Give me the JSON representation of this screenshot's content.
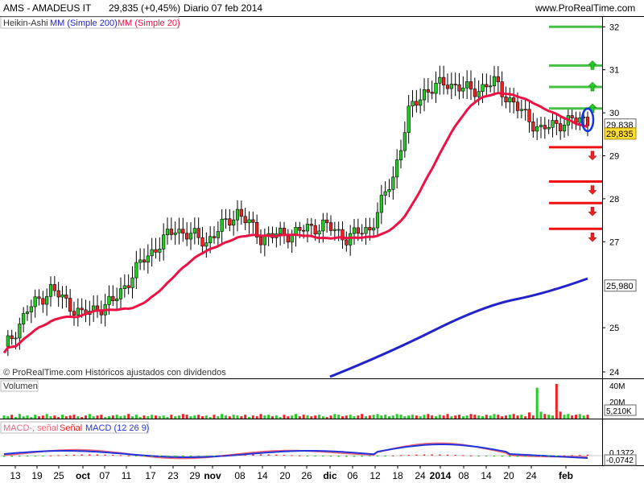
{
  "header": {
    "symbol_title": "AMS - AMADEUS IT",
    "price_change": "29,835 (+0,45%)",
    "period_date": "Diario 07 feb 2014",
    "site": "www.ProRealTime.com"
  },
  "legend": {
    "heikin": "Heikin-Ashi",
    "ma200": "MM (Simple 200)",
    "ma20": "MM (Simple 20)"
  },
  "watermark": "© ProRealTime.com  Históricos ajustados con dividendos",
  "colors": {
    "up": "#22cc22",
    "down": "#ee2222",
    "ma20": "#ee1144",
    "ma200": "#2222cc",
    "macd": "#2233dd",
    "signal": "#ee6677",
    "fill_up": "#66ee66",
    "fill_down": "#f08a96",
    "level_green": "#44c044",
    "level_red": "#ee1111"
  },
  "chart_data": {
    "type": "candlestick",
    "price_axis": {
      "ticks": [
        "32",
        "31",
        "30",
        "29",
        "28",
        "27",
        "25",
        "24"
      ]
    },
    "price_tags": [
      {
        "label": "29,838",
        "value": 29.838
      },
      {
        "label": "29,835",
        "value": 29.835
      },
      {
        "label": "25,980",
        "value": 25.98
      }
    ],
    "x_labels": [
      "13",
      "19",
      "25",
      "oct",
      "07",
      "11",
      "17",
      "23",
      "29",
      "nov",
      "08",
      "14",
      "20",
      "26",
      "dic",
      "06",
      "12",
      "18",
      "24",
      "2014",
      "08",
      "14",
      "20",
      "24",
      "feb"
    ],
    "levels": {
      "green": [
        32.0,
        31.1,
        30.6,
        30.1
      ],
      "red": [
        29.2,
        28.4,
        27.9,
        27.3
      ]
    },
    "volume": {
      "label": "Volumen",
      "ticks": [
        "40M",
        "20M"
      ],
      "current": "5,210K",
      "values": [
        4,
        3,
        5,
        2,
        6,
        3,
        4,
        2,
        5,
        3,
        4,
        6,
        3,
        4,
        2,
        5,
        3,
        4,
        5,
        3,
        2,
        4,
        6,
        3,
        4,
        5,
        2,
        3,
        4,
        5,
        3,
        4,
        6,
        3,
        5,
        2,
        4,
        3,
        5,
        4,
        3,
        4,
        2,
        5,
        3,
        4,
        6,
        5,
        3,
        4,
        5,
        3,
        4,
        2,
        5,
        3,
        6,
        4,
        3,
        5,
        4,
        3,
        5,
        2,
        4,
        3,
        6,
        4,
        5,
        3,
        4,
        2,
        5,
        3,
        4,
        6,
        3,
        5,
        4,
        3,
        4,
        5,
        3,
        2,
        4,
        6,
        5,
        3,
        4,
        5,
        3,
        4,
        6,
        3,
        4,
        5,
        6,
        4,
        5,
        3,
        4,
        6,
        5,
        3,
        4,
        5,
        4,
        3,
        5,
        6,
        4,
        3,
        5,
        4,
        6,
        3,
        4,
        5,
        3,
        4,
        6,
        5,
        4,
        3,
        5,
        4,
        6,
        5,
        3,
        4,
        5,
        6,
        4,
        5,
        3,
        8,
        4,
        40,
        9,
        6,
        5,
        4,
        45,
        9,
        5,
        6,
        4,
        5,
        6,
        4,
        5
      ]
    },
    "macd": {
      "legend_macd_signal": "MACD-, señal",
      "legend_signal": "Señal",
      "legend_macd": "MACD (12 26 9)",
      "values": [
        "0,1372",
        "-0,0742"
      ]
    }
  }
}
